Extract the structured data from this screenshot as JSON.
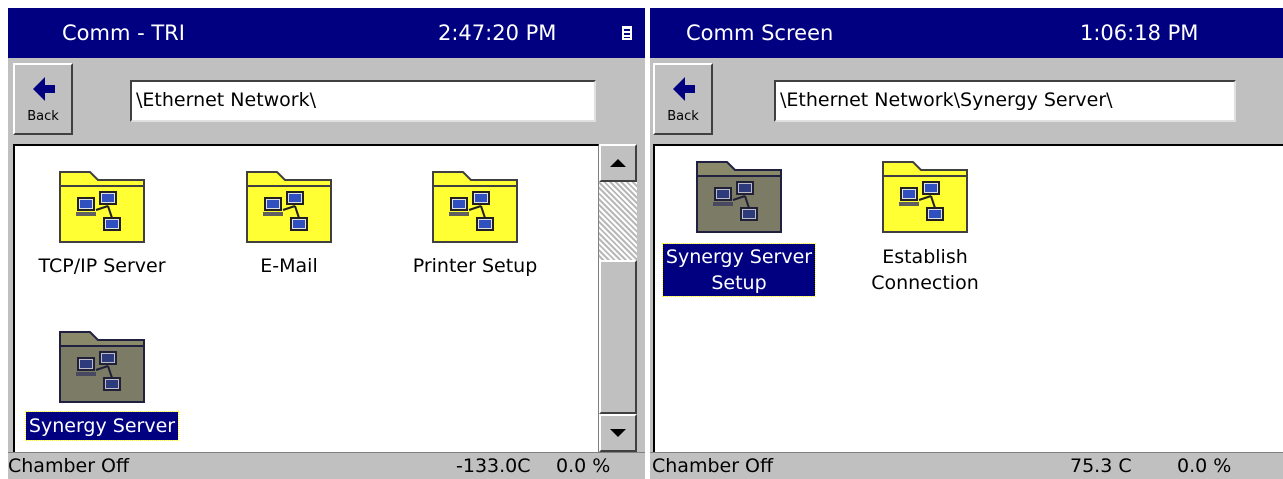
{
  "colors": {
    "title_bar": "#000080",
    "panel_bg": "#c0c0c0",
    "folder_yellow": "#ffff33",
    "selected_bg": "#000080"
  },
  "left_panel": {
    "title": "Comm - TRI",
    "clock": "2:47:20 PM",
    "title_icon": "keyboard-icon",
    "back_button_label": "Back",
    "back_icon": "back-arrow-icon",
    "path": "\\Ethernet Network\\",
    "items": [
      {
        "label": "TCP/IP Server",
        "icon": "network-folder-icon",
        "selected": false
      },
      {
        "label": "E-Mail",
        "icon": "network-folder-icon",
        "selected": false
      },
      {
        "label": "Printer Setup",
        "icon": "network-folder-icon",
        "selected": false
      },
      {
        "label": "Synergy Server",
        "icon": "network-folder-icon",
        "selected": true
      }
    ],
    "scrollbar": {
      "up_icon": "scroll-up-icon",
      "down_icon": "scroll-down-icon"
    },
    "status": {
      "left": "Chamber Off",
      "temp": "-133.0C",
      "percent": "0.0 %"
    }
  },
  "right_panel": {
    "title": "Comm Screen",
    "clock": "1:06:18 PM",
    "back_button_label": "Back",
    "back_icon": "back-arrow-icon",
    "path": "\\Ethernet Network\\Synergy Server\\",
    "items": [
      {
        "label_line1": "Synergy Server",
        "label_line2": "Setup",
        "icon": "network-folder-icon",
        "selected": true
      },
      {
        "label_line1": "Establish",
        "label_line2": "Connection",
        "icon": "network-folder-icon",
        "selected": false
      }
    ],
    "status": {
      "left": "Chamber Off",
      "temp": "75.3 C",
      "percent": "0.0 %"
    }
  }
}
